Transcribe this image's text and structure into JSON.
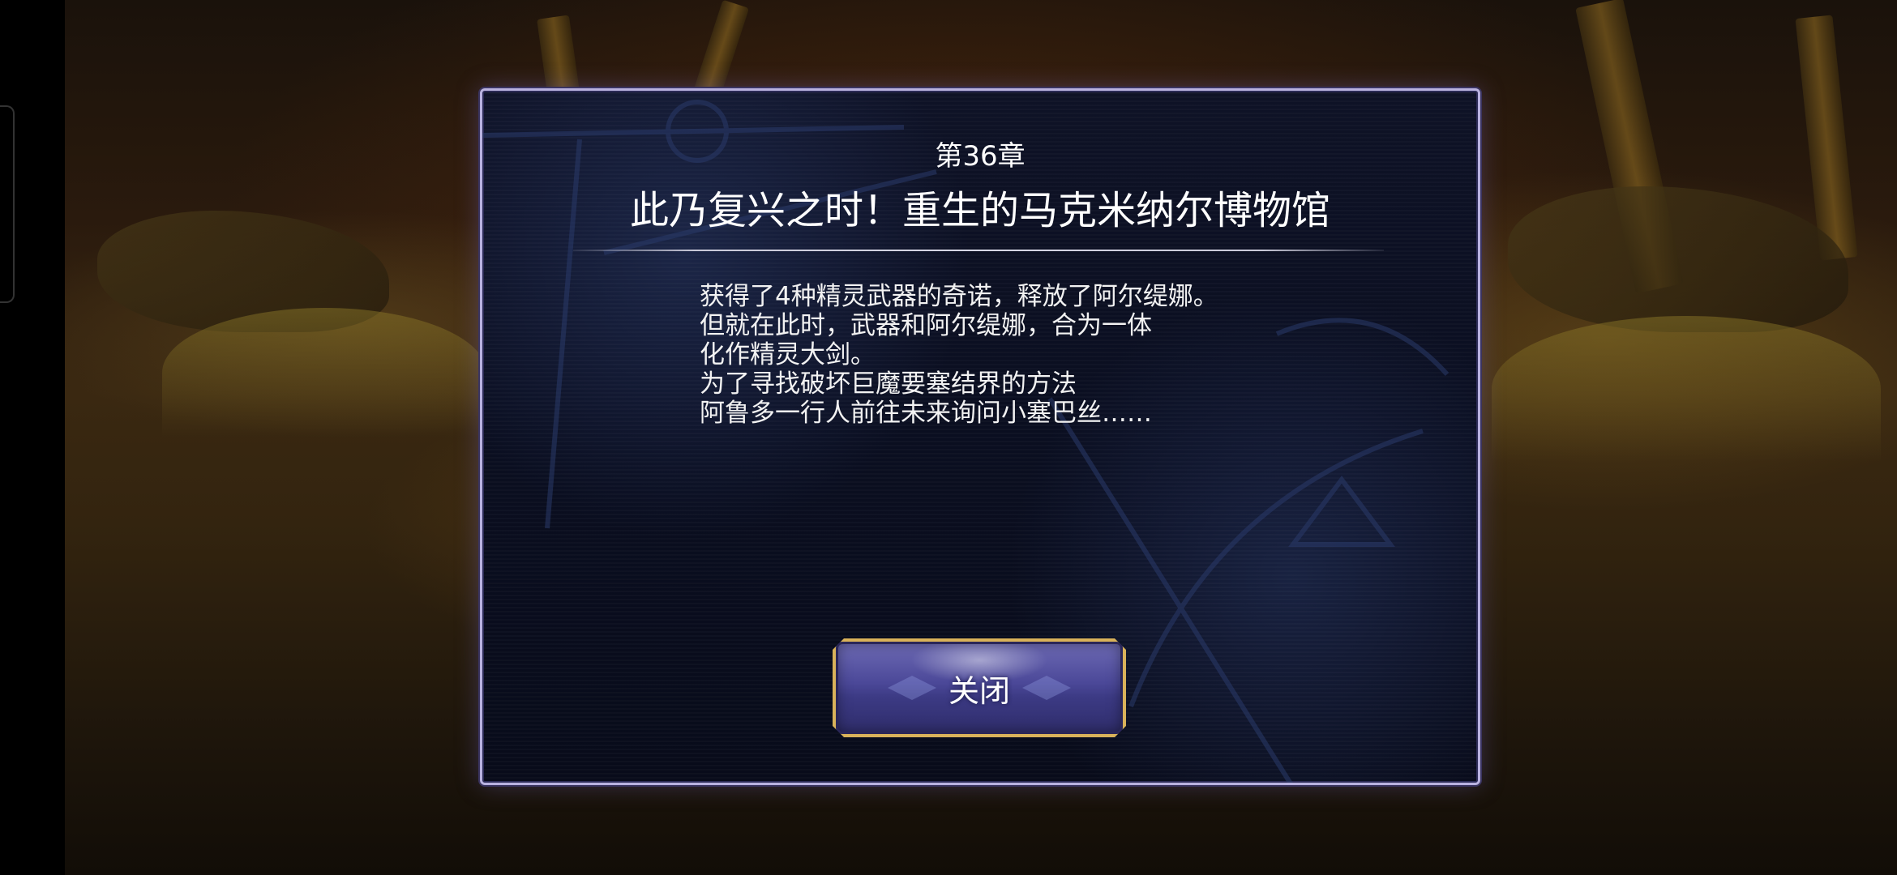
{
  "dialog": {
    "chapter": "第36章",
    "title": "此乃复兴之时！重生的马克米纳尔博物馆",
    "body_lines": [
      "获得了4种精灵武器的奇诺，释放了阿尔缇娜。",
      "但就在此时，武器和阿尔缇娜，合为一体",
      "化作精灵大剑。",
      "为了寻找破坏巨魔要塞结界的方法",
      "阿鲁多一行人前往未来询问小塞巴丝……"
    ],
    "close_label": "关闭"
  },
  "colors": {
    "dialog_border": "#b9b2e0",
    "dialog_bg": "#0a0e20",
    "button_gold": "#d9b25a",
    "button_purple": "#4b4898"
  }
}
